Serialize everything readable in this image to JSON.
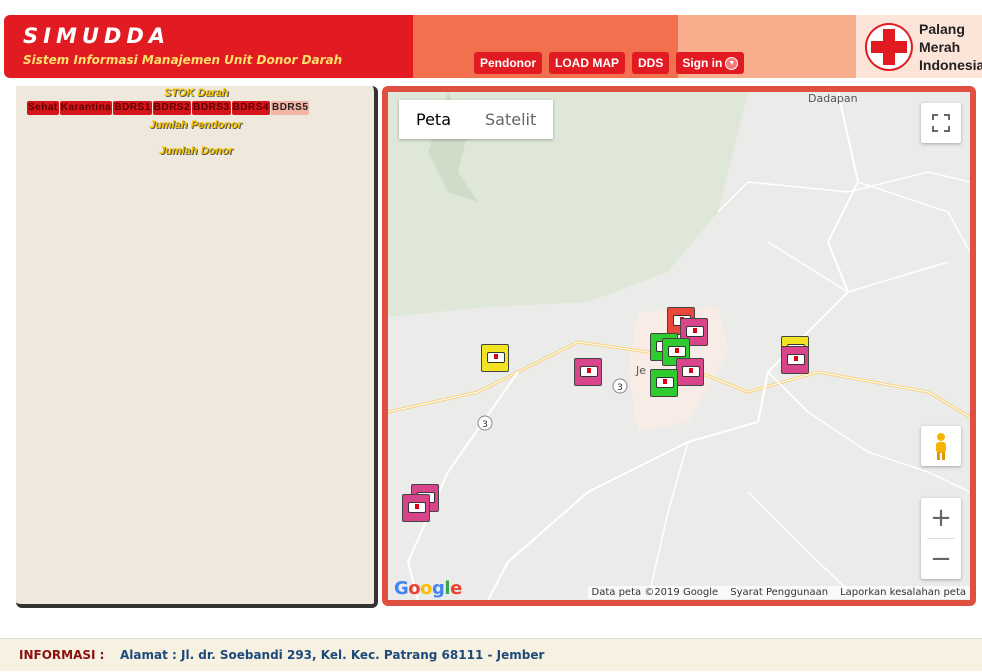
{
  "header": {
    "title": "SIMUDDA",
    "subtitle": "Sistem Informasi Manajemen Unit Donor Darah",
    "nav": [
      "Pendonor",
      "LOAD MAP",
      "DDS",
      "Sign in"
    ],
    "logo_text": [
      "Palang",
      "Merah",
      "Indonesia"
    ],
    "colors": {
      "brand": "#e21b23",
      "band1": "#f2704e",
      "band2": "#f8ad8d",
      "band3": "#fde4d8"
    }
  },
  "left_panel": {
    "stok_title": "STOK Darah",
    "categories": [
      "Sehat",
      "Karantina",
      "BDRS1",
      "BDRS2",
      "BDRS3",
      "BDRS4",
      "BDRS5"
    ],
    "jumlah_pendonor": "Jumlah Pendonor",
    "jumlah_donor": "Jumlah Donor"
  },
  "map": {
    "type_buttons": [
      "Peta",
      "Satelit"
    ],
    "active_type": "Peta",
    "places": {
      "dadapan": "Dadapan",
      "je": "Je"
    },
    "road_shield": "3",
    "google": "Google",
    "attribution": [
      "Data peta ©2019 Google",
      "Syarat Penggunaan",
      "Laporkan kesalahan peta"
    ],
    "zoom_in": "+",
    "zoom_out": "−",
    "marker_colors": {
      "pink": "#d9458a",
      "green": "#2ecc2e",
      "yellow": "#f2e422",
      "red": "#e8473a"
    }
  },
  "footer": {
    "label": "INFORMASI :",
    "address": "Alamat : Jl. dr. Soebandi 293, Kel. Kec. Patrang 68111 - Jember"
  }
}
